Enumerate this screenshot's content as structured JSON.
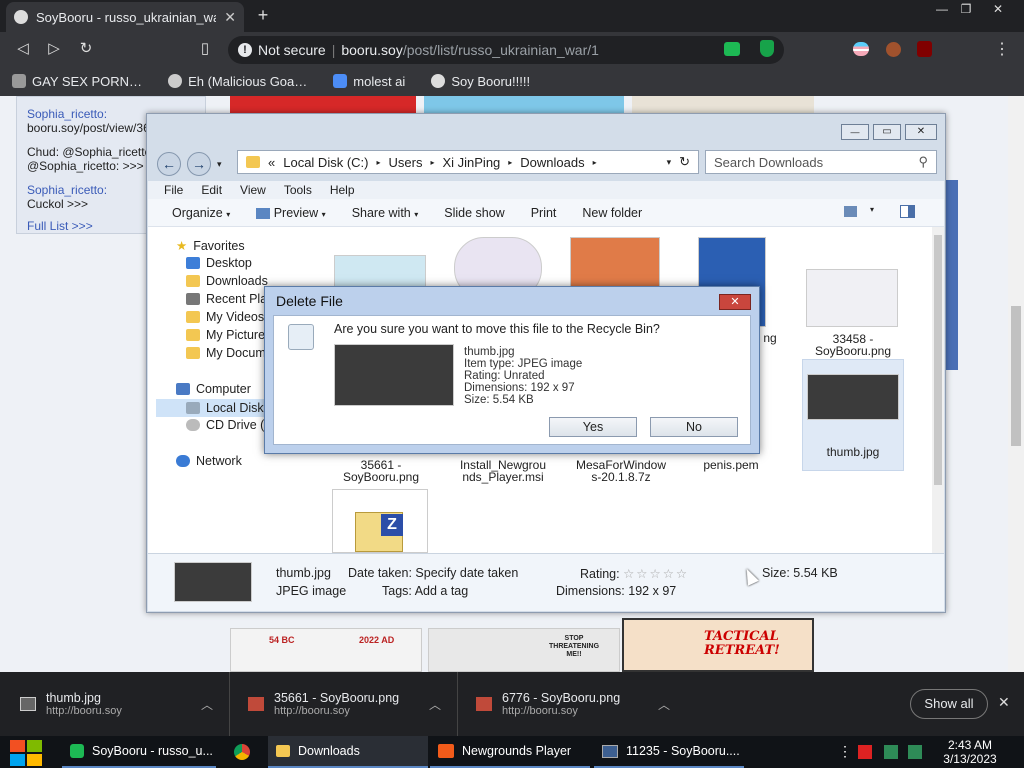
{
  "browser": {
    "tab_title": "SoyBooru - russo_ukrainian_war",
    "new_tab": "+",
    "security": "Not secure",
    "url_host": "booru.soy",
    "url_path": "/post/list/russo_ukrainian_war/1",
    "bookmarks": [
      "GAY SEX PORN…",
      "Eh (Malicious Goa…",
      "molest ai",
      "Soy Booru!!!!!"
    ]
  },
  "chat": {
    "lines": [
      {
        "user": "Sophia_ricetto:",
        "text": "booru.soy/post/view/36"
      },
      {
        "user": "Chud: @Sophia_ricetto",
        "text": "@Sophia_ricetto: >>>"
      },
      {
        "user": "Sophia_ricetto:",
        "text": "Cuckol >>>"
      }
    ],
    "full_list": "Full List >>>"
  },
  "explorer": {
    "breadcrumb": [
      "«",
      "Local Disk (C:)",
      "Users",
      "Xi JinPing",
      "Downloads"
    ],
    "search_placeholder": "Search Downloads",
    "menu": [
      "File",
      "Edit",
      "View",
      "Tools",
      "Help"
    ],
    "commands": [
      "Organize",
      "Preview",
      "Share with",
      "Slide show",
      "Print",
      "New folder"
    ],
    "nav": {
      "favorites": "Favorites",
      "fav_items": [
        "Desktop",
        "Downloads",
        "Recent Pla",
        "My Videos",
        "My Picture",
        "My Docum"
      ],
      "computer": "Computer",
      "comp_items": [
        "Local Disk",
        "CD Drive ("
      ],
      "network": "Network"
    },
    "files": {
      "f1": "33458 - SoyBooru.png",
      "f2a": "35661 -",
      "f2b": "SoyBooru.png",
      "f3a": "Install_Newgrou",
      "f3b": "nds_Player.msi",
      "f4a": "MesaForWindow",
      "f4b": "s-20.1.8.7z",
      "f5": "penis.pem",
      "f6": "thumb.jpg",
      "f7": "ng"
    },
    "details": {
      "name": "thumb.jpg",
      "type": "JPEG image",
      "date_label": "Date taken:",
      "date_value": "Specify date taken",
      "tags_label": "Tags:",
      "tags_value": "Add a tag",
      "rating_label": "Rating:",
      "dims_label": "Dimensions:",
      "dims_value": "192 x 97",
      "size_label": "Size:",
      "size_value": "5.54 KB"
    }
  },
  "dialog": {
    "title": "Delete File",
    "question": "Are you sure you want to move this file to the Recycle Bin?",
    "name": "thumb.jpg",
    "type": "Item type: JPEG image",
    "rating": "Rating: Unrated",
    "dims": "Dimensions: 192 x 97",
    "size": "Size: 5.54 KB",
    "yes": "Yes",
    "no": "No"
  },
  "downloads": {
    "items": [
      {
        "name": "thumb.jpg",
        "src": "http://booru.soy"
      },
      {
        "name": "35661 - SoyBooru.png",
        "src": "http://booru.soy"
      },
      {
        "name": "6776 - SoyBooru.png",
        "src": "http://booru.soy"
      }
    ],
    "show_all": "Show all"
  },
  "taskbar": {
    "items": [
      "SoyBooru - russo_u...",
      "Downloads",
      "Newgrounds Player",
      "11235 - SoyBooru...."
    ],
    "time": "2:43 AM",
    "date": "3/13/2023"
  },
  "page_images": {
    "tactical": "TACTICAL RETREAT!",
    "stop": "STOP THREATENING ME!!",
    "bc": "54 BC",
    "ad": "2022 AD"
  }
}
